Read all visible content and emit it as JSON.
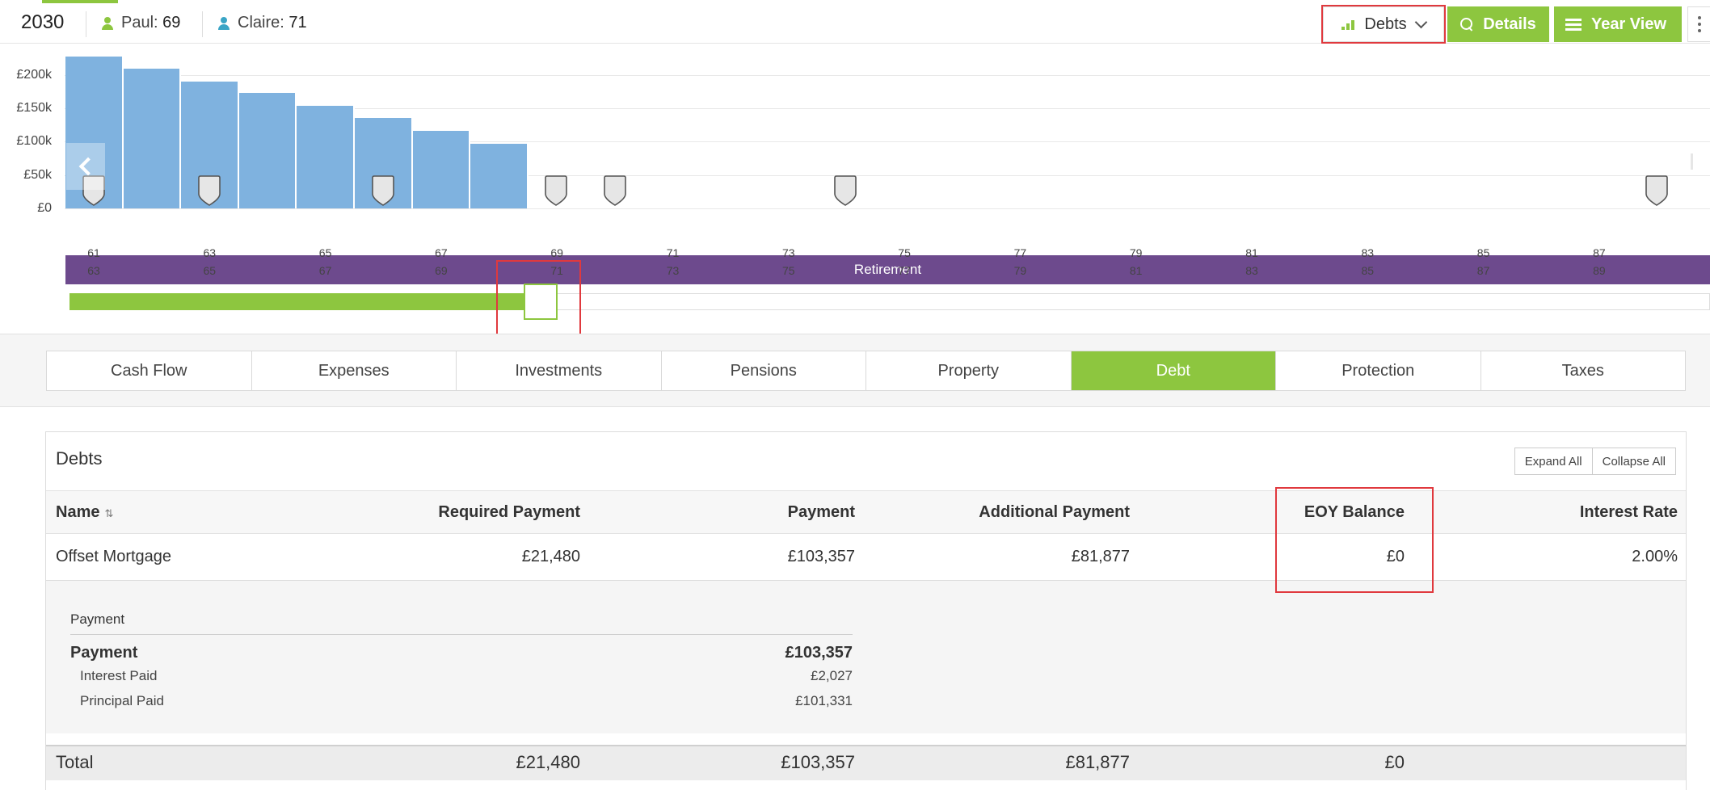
{
  "header": {
    "year": "2030",
    "people": [
      {
        "name": "Paul:",
        "age": "69",
        "color": "#8dc63f"
      },
      {
        "name": "Claire:",
        "age": "71",
        "color": "#3aa5c6"
      }
    ],
    "view_select": {
      "label": "Debts",
      "icon": "bar-chart-icon"
    },
    "details_button": {
      "label": "Details",
      "icon": "search-icon"
    },
    "year_view_button": {
      "label": "Year View",
      "icon": "list-icon"
    }
  },
  "chart_data": {
    "type": "bar",
    "y_ticks": [
      "£200k",
      "£150k",
      "£100k",
      "£50k",
      "£0"
    ],
    "ylim": [
      0,
      230000
    ],
    "values": [
      228000,
      210000,
      190000,
      173000,
      154000,
      135000,
      116000,
      97000
    ],
    "band_label": "Retirement",
    "ages_paul": [
      "61",
      "63",
      "65",
      "67",
      "69",
      "71",
      "73",
      "75",
      "77",
      "79",
      "81",
      "83",
      "85",
      "87"
    ],
    "ages_claire": [
      "63",
      "65",
      "67",
      "69",
      "71",
      "73",
      "75",
      "77",
      "79",
      "81",
      "83",
      "85",
      "87",
      "89"
    ],
    "colors": {
      "bar": "#7fb2df",
      "band": "#6d4a8d",
      "accent": "#8dc63f"
    }
  },
  "slider": {
    "selected_year_index": 8
  },
  "tabs": [
    {
      "label": "Cash Flow",
      "active": false
    },
    {
      "label": "Expenses",
      "active": false
    },
    {
      "label": "Investments",
      "active": false
    },
    {
      "label": "Pensions",
      "active": false
    },
    {
      "label": "Property",
      "active": false
    },
    {
      "label": "Debt",
      "active": true
    },
    {
      "label": "Protection",
      "active": false
    },
    {
      "label": "Taxes",
      "active": false
    }
  ],
  "debts": {
    "title": "Debts",
    "expand_all": "Expand All",
    "collapse_all": "Collapse All",
    "columns": {
      "name": "Name",
      "required": "Required Payment",
      "payment": "Payment",
      "additional": "Additional Payment",
      "eoy": "EOY Balance",
      "rate": "Interest Rate"
    },
    "row": {
      "name": "Offset Mortgage",
      "required": "£21,480",
      "payment": "£103,357",
      "additional": "£81,877",
      "eoy": "£0",
      "rate": "2.00%"
    },
    "detail": {
      "heading": "Payment",
      "payment_label": "Payment",
      "payment_value": "£103,357",
      "interest_label": "Interest Paid",
      "interest_value": "£2,027",
      "principal_label": "Principal Paid",
      "principal_value": "£101,331"
    },
    "total": {
      "label": "Total",
      "required": "£21,480",
      "payment": "£103,357",
      "additional": "£81,877",
      "eoy": "£0"
    }
  }
}
